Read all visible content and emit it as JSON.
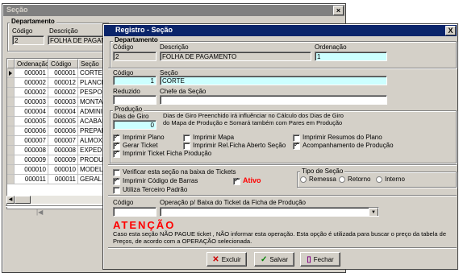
{
  "back_window": {
    "title": "Seção",
    "group_title": "Departamento",
    "codigo_label": "Código",
    "descricao_label": "Descrição",
    "codigo_value": "2",
    "descricao_value": "FOLHA DE PAGAMENTO",
    "columns": [
      "Ordenação",
      "Código",
      "Seção"
    ],
    "rows": [
      {
        "ordenacao": "000001",
        "codigo": "000001",
        "secao": "CORTE"
      },
      {
        "ordenacao": "000002",
        "codigo": "000012",
        "secao": "PLANCH"
      },
      {
        "ordenacao": "000002",
        "codigo": "000002",
        "secao": "PESPON"
      },
      {
        "ordenacao": "000003",
        "codigo": "000003",
        "secao": "MONTAG"
      },
      {
        "ordenacao": "000004",
        "codigo": "000004",
        "secao": "ADMINIS"
      },
      {
        "ordenacao": "000005",
        "codigo": "000005",
        "secao": "ACABAM"
      },
      {
        "ordenacao": "000006",
        "codigo": "000006",
        "secao": "PREPAR"
      },
      {
        "ordenacao": "000007",
        "codigo": "000007",
        "secao": "ALMOXA"
      },
      {
        "ordenacao": "000008",
        "codigo": "000008",
        "secao": "EXPEDIC"
      },
      {
        "ordenacao": "000009",
        "codigo": "000009",
        "secao": "PRODUC"
      },
      {
        "ordenacao": "000010",
        "codigo": "000010",
        "secao": "MODELA"
      },
      {
        "ordenacao": "000011",
        "codigo": "000011",
        "secao": "GERAL"
      }
    ]
  },
  "dialog": {
    "title": "Registro - Seção",
    "dept_group": "Departamento",
    "codigo_label": "Código",
    "descricao_label": "Descrição",
    "ordenacao_label": "Ordenação",
    "dept_codigo": "2",
    "dept_descricao": "FOLHA DE PAGAMENTO",
    "ordenacao_value": "1",
    "secao_codigo_label": "Código",
    "secao_label": "Seção",
    "secao_codigo": "1",
    "secao_value": "CORTE",
    "reduzido_label": "Reduzido",
    "chefe_label": "Chefe da Seção",
    "reduzido_value": "",
    "chefe_value": "",
    "producao_group": "Produção",
    "dias_giro_label": "Dias de Giro",
    "dias_giro_value": "0",
    "dias_giro_note": "Dias de Giro Preenchido irá influênciar no Cálculo dos Dias de Giro do Mapa de Produção e Somará também com Pares em Produção",
    "checks": {
      "imprimir_plano": "Imprimir Plano",
      "gerar_ticket": "Gerar Ticket",
      "imprimir_ticket_ficha": "Imprimir Ticket Ficha Produção",
      "imprimir_mapa": "Imprimir Mapa",
      "imprimir_rel_ficha": "Imprimir Rel.Ficha Aberto Seção",
      "imprimir_resumos": "Imprimir Resumos do Plano",
      "acompanhamento": "Acompanhamento de Produção",
      "verificar_baixa": "Verificar esta seção na baixa de Tickets",
      "imprimir_codigo_barras": "Imprimir Código de Barras",
      "utiliza_terceiro": "Utiliza Terceiro Padrão",
      "ativo": "Ativo"
    },
    "tipo_group": "Tipo de Seção",
    "tipo_options": [
      "Remessa",
      "Retorno",
      "Interno"
    ],
    "op_codigo_label": "Código",
    "operacao_label": "Operação p/ Baixa do Ticket da Ficha de Produção",
    "op_codigo_value": "",
    "operacao_value": "",
    "atencao_title": "ATENÇÃO",
    "atencao_text": "Caso esta seção NÃO PAGUE ticket , NÃO informar esta operação. Esta opção é utilizada para buscar o preço da tabela de Preços, de acordo com a OPERAÇÃO selecionada.",
    "buttons": {
      "excluir": "Excluir",
      "salvar": "Salvar",
      "fechar": "Fechar"
    },
    "close_glyph": "X"
  },
  "colors": {
    "active_title": "#0a246a",
    "inactive_title": "#808080",
    "face": "#d4d0c8",
    "highlight_field": "#ccffff",
    "atencao": "#ff0000",
    "ativo": "#ff0000"
  }
}
